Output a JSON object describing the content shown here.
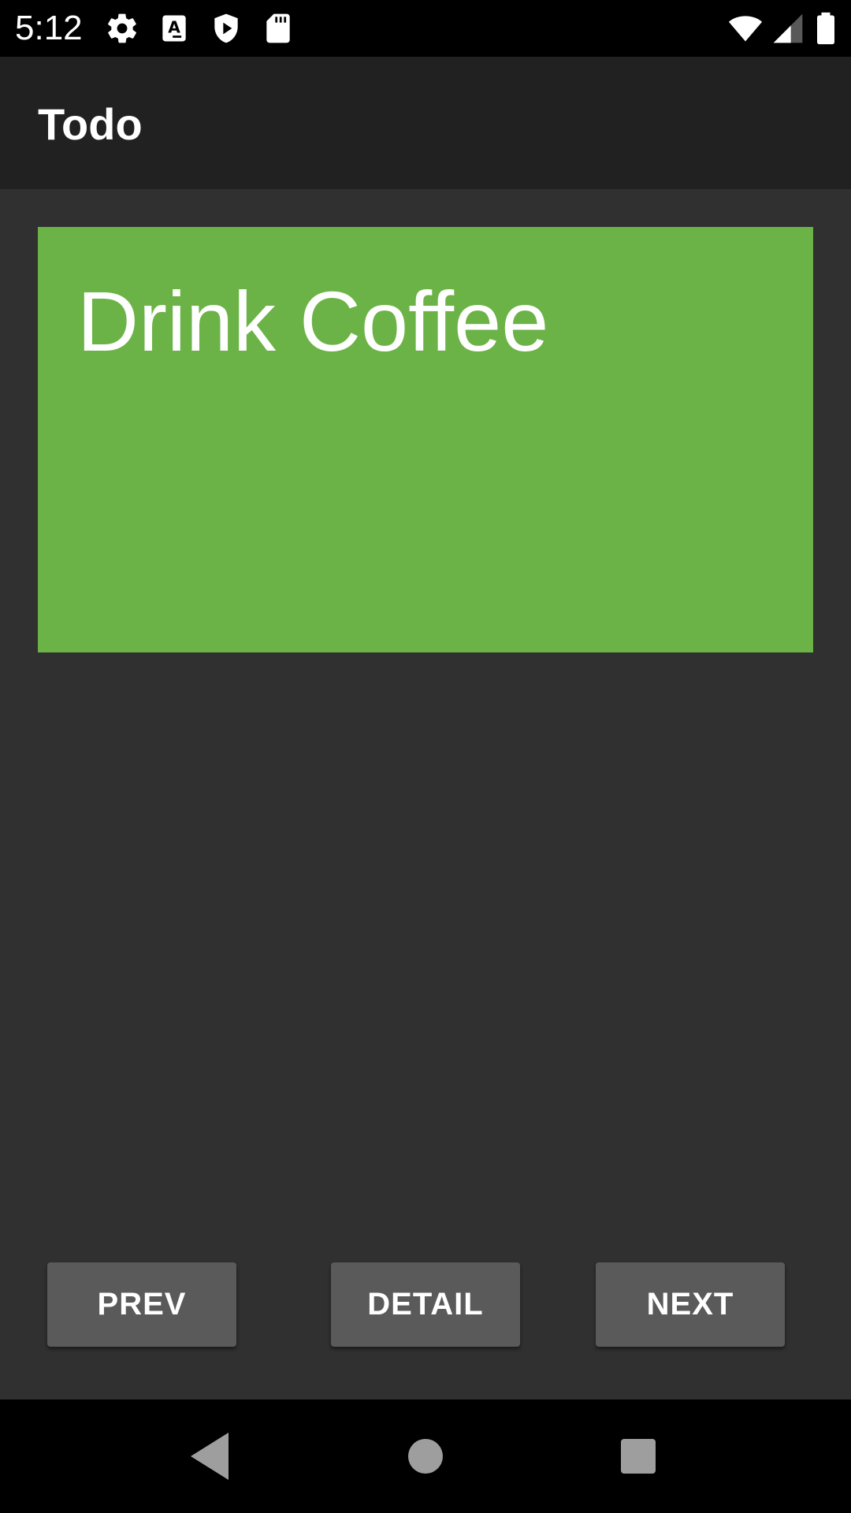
{
  "status_bar": {
    "time": "5:12",
    "icons_left": [
      "settings-icon",
      "text-a-icon",
      "shield-play-icon",
      "sd-card-icon"
    ],
    "icons_right": [
      "wifi-icon",
      "signal-icon",
      "battery-icon"
    ]
  },
  "app_bar": {
    "title": "Todo"
  },
  "todo": {
    "title": "Drink Coffee",
    "card_color": "#6cb347"
  },
  "buttons": {
    "prev": "PREV",
    "detail": "DETAIL",
    "next": "NEXT"
  },
  "nav_bar": {
    "icons": [
      "back-icon",
      "home-icon",
      "recents-icon"
    ]
  },
  "colors": {
    "background": "#303030",
    "app_bar": "#212121",
    "button": "#5a5a5b"
  }
}
